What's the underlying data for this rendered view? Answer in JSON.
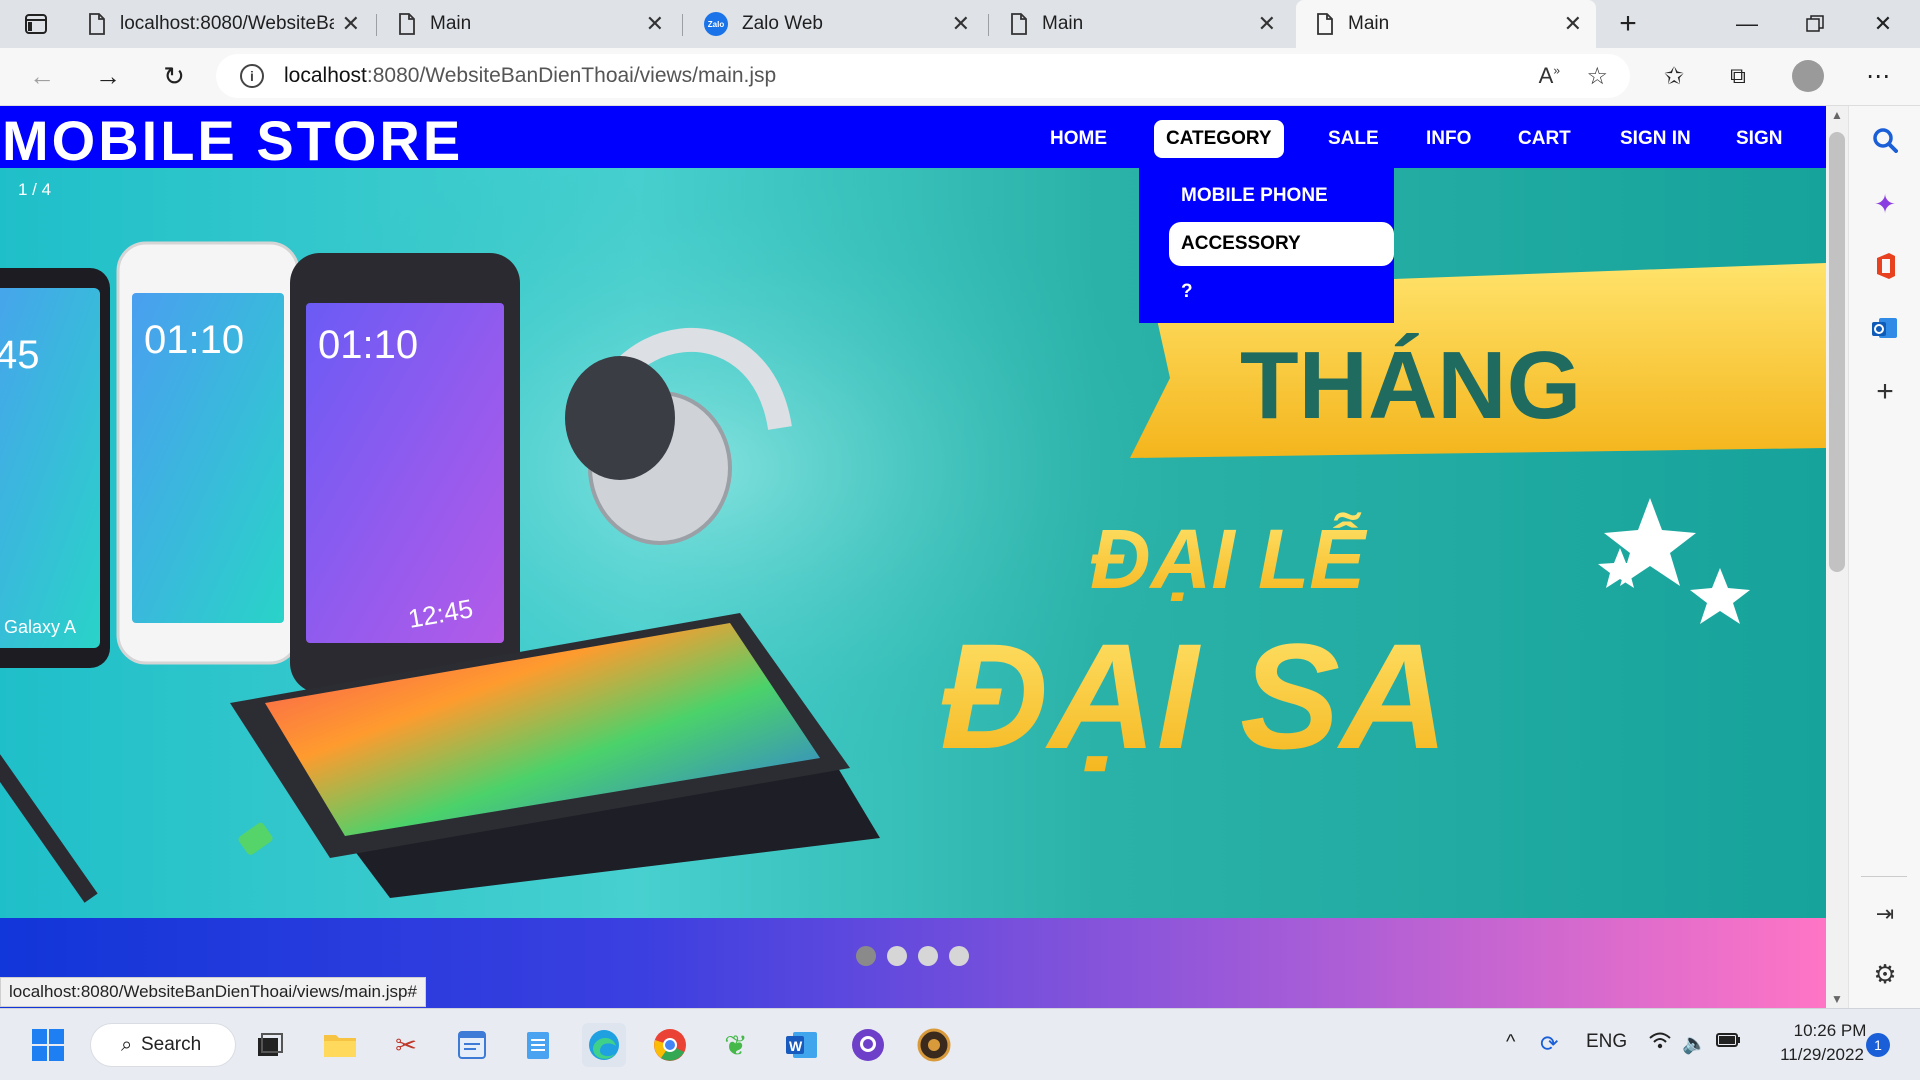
{
  "browser": {
    "tabs": [
      {
        "label": "localhost:8080/WebsiteBa",
        "active": false,
        "icon": "page-icon"
      },
      {
        "label": "Main",
        "active": false,
        "icon": "page-icon"
      },
      {
        "label": "Zalo Web",
        "active": false,
        "icon": "zalo-icon"
      },
      {
        "label": "Main",
        "active": false,
        "icon": "page-icon"
      },
      {
        "label": "Main",
        "active": true,
        "icon": "page-icon"
      }
    ],
    "url_host": "localhost",
    "url_rest": ":8080/WebsiteBanDienThoai/views/main.jsp",
    "status_url": "localhost:8080/WebsiteBanDienThoai/views/main.jsp#"
  },
  "site": {
    "logo": "MOBILE STORE",
    "menu": [
      "HOME",
      "CATEGORY",
      "SALE",
      "INFO",
      "CART",
      "SIGN IN",
      "SIGN UP"
    ],
    "active_menu": "CATEGORY",
    "dropdown": [
      "MOBILE PHONE",
      "ACCESSORY",
      "?"
    ],
    "active_dropdown": "ACCESSORY",
    "brand_color": "#0000ff"
  },
  "banner": {
    "counter": "1 / 4",
    "headline_1": "THÁNG",
    "headline_2": "ĐẠI LỄ",
    "headline_3": "ĐẠI SA",
    "phone_time": "01:10",
    "tablet_time": "12:45",
    "phone_brand": "Galaxy A",
    "partial_time": "45",
    "slide_count": 4,
    "active_slide": 1
  },
  "taskbar": {
    "search_label": "Search",
    "language": "ENG",
    "time": "10:26 PM",
    "date": "11/29/2022",
    "notification_count": "1"
  }
}
